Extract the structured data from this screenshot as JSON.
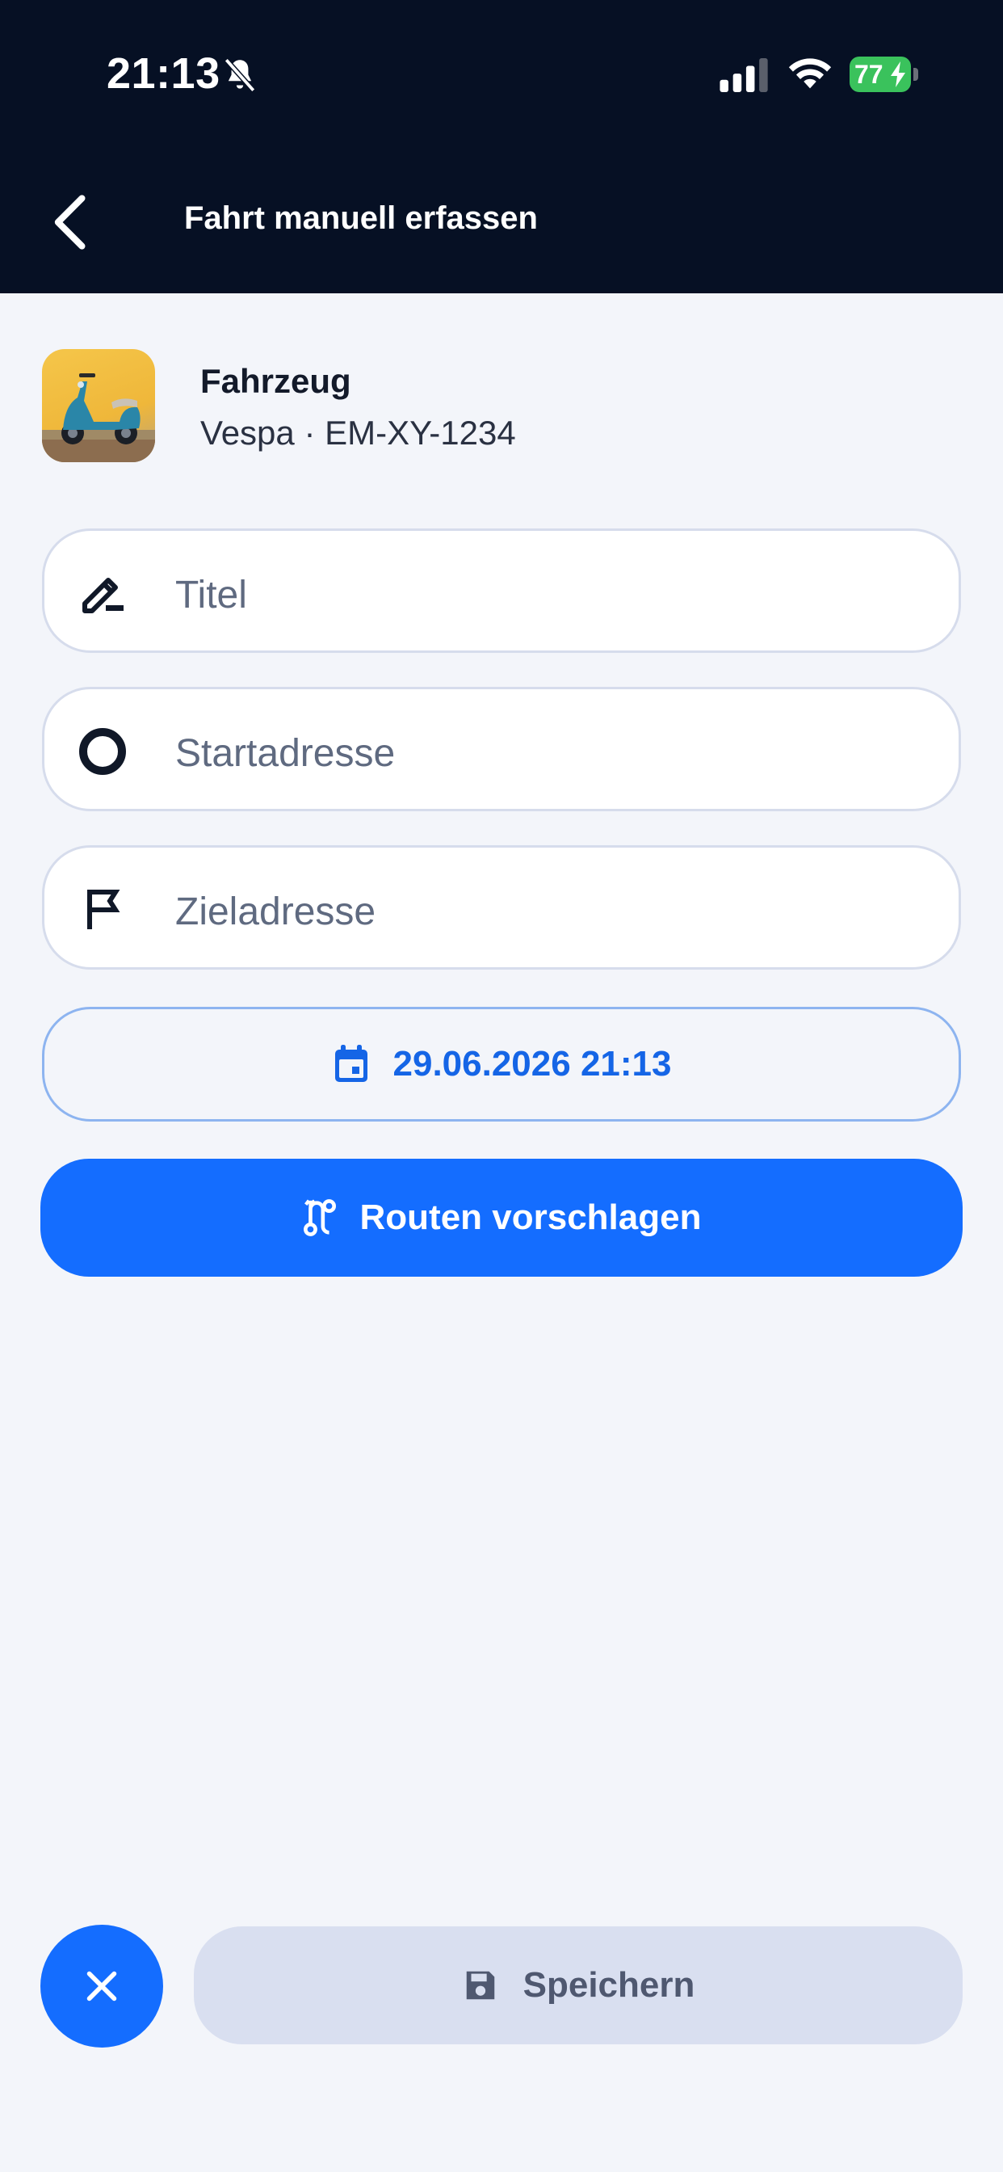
{
  "status_bar": {
    "time": "21:13",
    "battery": "77",
    "icons": [
      "bell-slash-icon",
      "cellular-signal-icon",
      "wifi-icon",
      "battery-charging-icon"
    ]
  },
  "header": {
    "title": "Fahrt manuell erfassen",
    "back_icon": "chevron-left-icon"
  },
  "vehicle": {
    "label": "Fahrzeug",
    "value": "Vespa · EM-XY-1234"
  },
  "form": {
    "title_placeholder": "Titel",
    "start_placeholder": "Startadresse",
    "destination_placeholder": "Zieladresse",
    "datetime": "29.06.2026 21:13",
    "suggest_routes_label": "Routen vorschlagen"
  },
  "footer": {
    "close_icon": "close-icon",
    "save_label": "Speichern"
  },
  "colors": {
    "header_bg": "#061024",
    "page_bg": "#f3f5fa",
    "primary": "#146dff",
    "date_text": "#1565e6",
    "save_bg": "#d9dff0",
    "battery_green": "#3ac25c"
  }
}
